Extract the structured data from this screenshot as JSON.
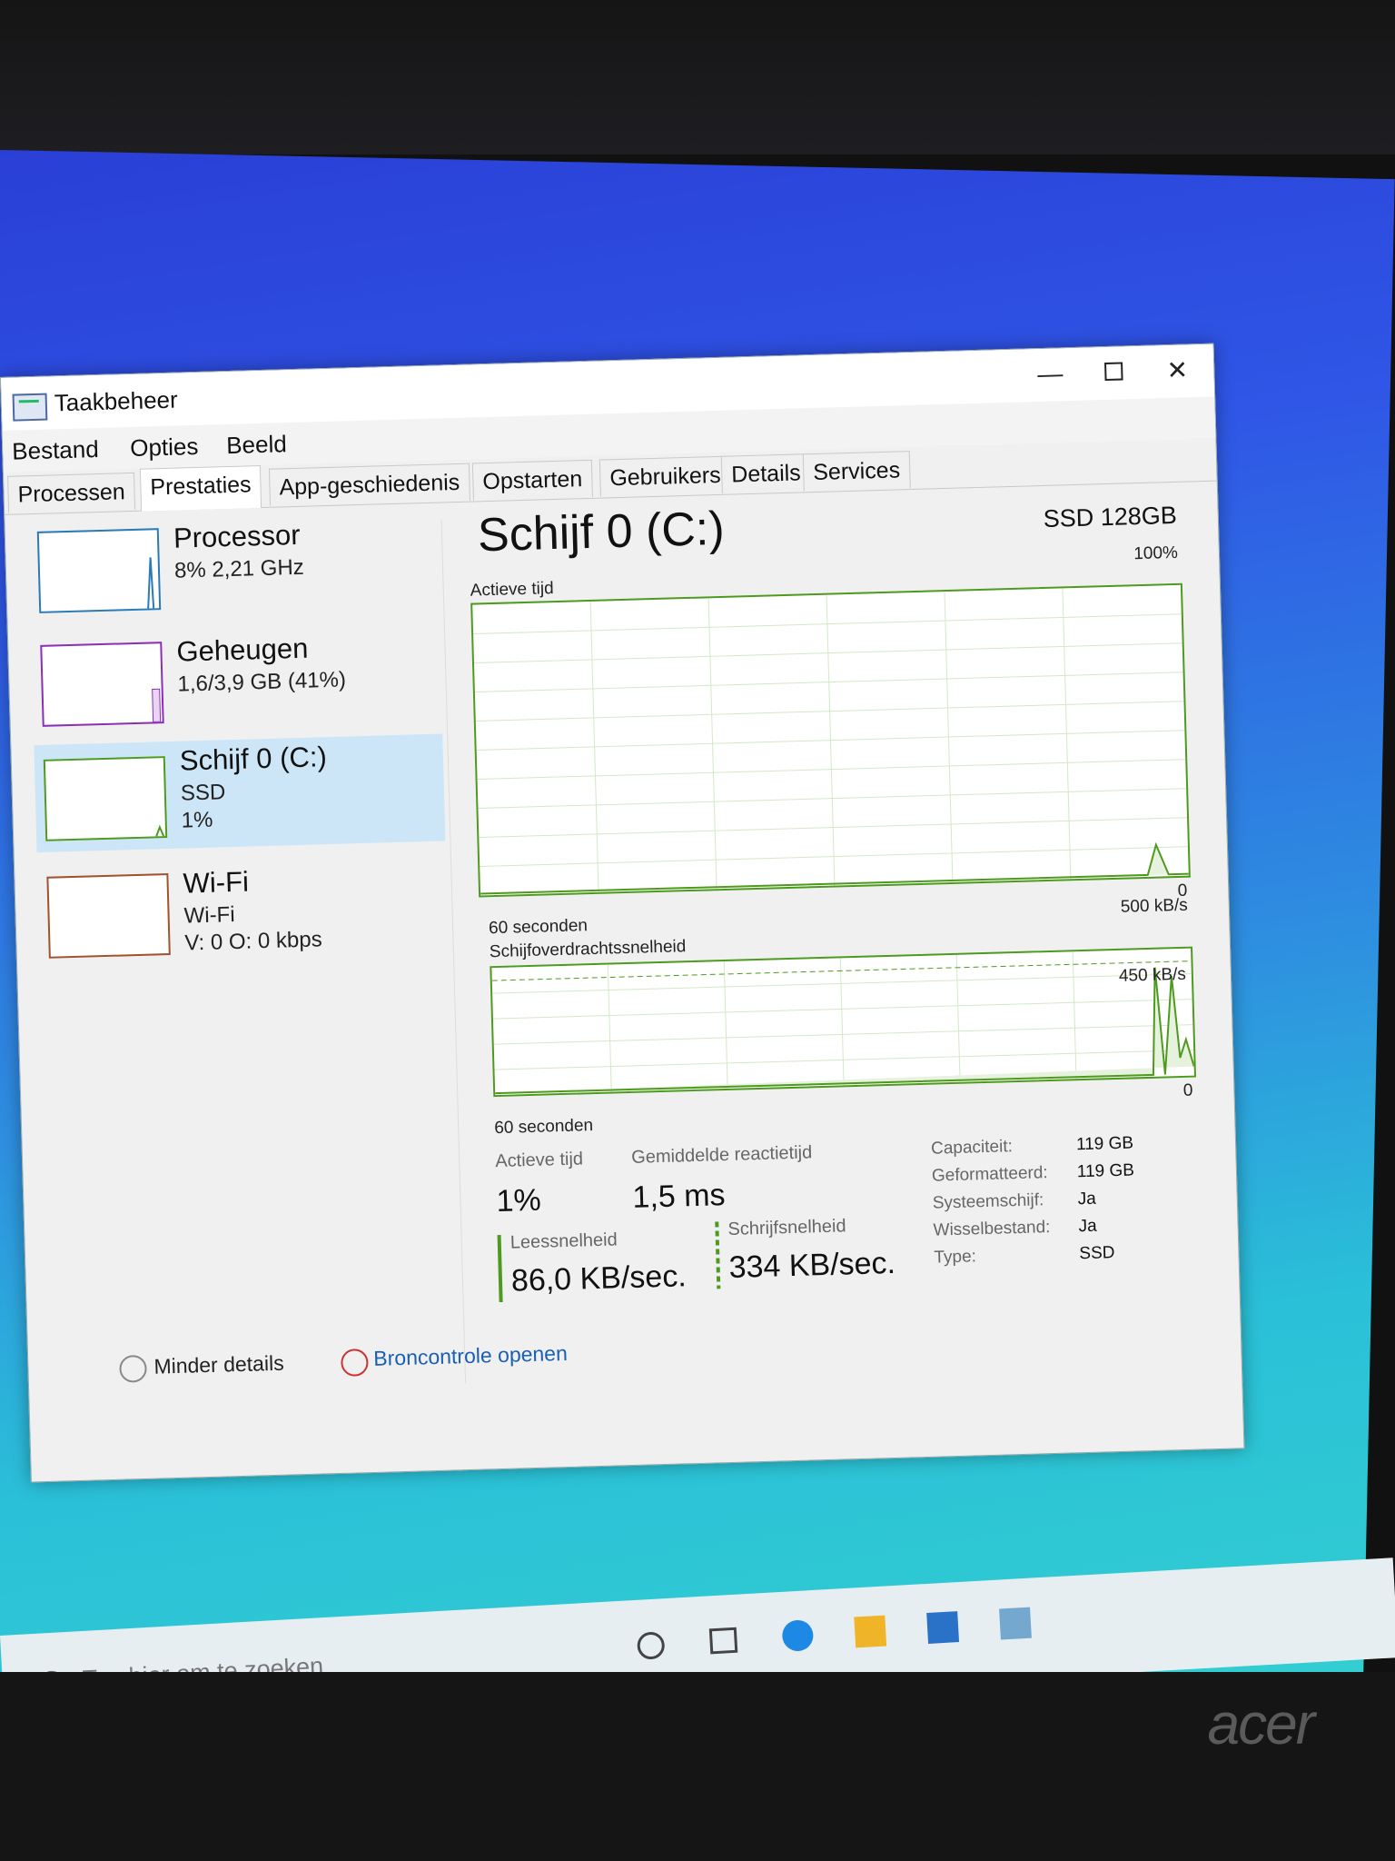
{
  "window": {
    "title": "Taakbeheer",
    "controls": {
      "minimize": "—",
      "close": "✕"
    }
  },
  "menu": [
    "Bestand",
    "Opties",
    "Beeld"
  ],
  "tabs": [
    "Processen",
    "Prestaties",
    "App-geschiedenis",
    "Opstarten",
    "Gebruikers",
    "Details",
    "Services"
  ],
  "active_tab": "Prestaties",
  "resources": [
    {
      "name": "Processor",
      "line1": "8% 2,21 GHz",
      "line2": ""
    },
    {
      "name": "Geheugen",
      "line1": "1,6/3,9 GB (41%)",
      "line2": ""
    },
    {
      "name": "Schijf 0 (C:)",
      "line1": "SSD",
      "line2": "1%"
    },
    {
      "name": "Wi-Fi",
      "line1": "Wi-Fi",
      "line2": "V: 0 O: 0 kbps"
    }
  ],
  "detail": {
    "title": "Schijf 0 (C:)",
    "model": "SSD 128GB",
    "active_graph": {
      "label": "Actieve tijd",
      "max": "100%",
      "min": "0",
      "duration": "60 seconden"
    },
    "transfer_graph": {
      "label": "Schijfoverdrachtssnelheid",
      "max": "500 kB/s",
      "marker": "450 kB/s",
      "min": "0",
      "duration": "60 seconden"
    },
    "stats": {
      "active_time_label": "Actieve tijd",
      "active_time_value": "1%",
      "avg_response_label": "Gemiddelde reactietijd",
      "avg_response_value": "1,5 ms",
      "read_label": "Leessnelheid",
      "read_value": "86,0 KB/sec.",
      "write_label": "Schrijfsnelheid",
      "write_value": "334 KB/sec."
    },
    "properties": [
      {
        "key": "Capaciteit:",
        "value": "119 GB"
      },
      {
        "key": "Geformatteerd:",
        "value": "119 GB"
      },
      {
        "key": "Systeemschijf:",
        "value": "Ja"
      },
      {
        "key": "Wisselbestand:",
        "value": "Ja"
      },
      {
        "key": "Type:",
        "value": "SSD"
      }
    ]
  },
  "footer": {
    "less_details": "Minder details",
    "resource_monitor": "Broncontrole openen"
  },
  "taskbar": {
    "search_placeholder": "Typ hier om te zoeken"
  },
  "brand": "acer",
  "colors": {
    "disk_green": "#4d9a1e",
    "selection": "#cde6f7",
    "link": "#1a5fb4"
  }
}
